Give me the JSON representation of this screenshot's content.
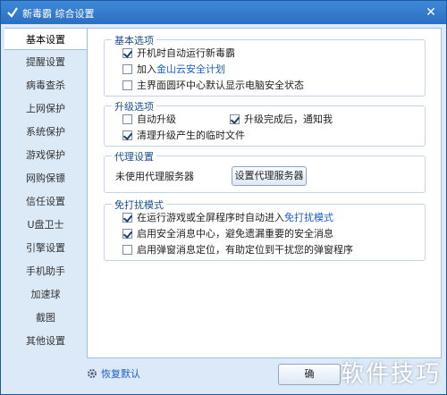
{
  "window": {
    "title": "新毒霸 综合设置",
    "close_glyph": "✕"
  },
  "sidebar": {
    "items": [
      {
        "label": "基本设置",
        "active": true
      },
      {
        "label": "提醒设置"
      },
      {
        "label": "病毒查杀"
      },
      {
        "label": "上网保护"
      },
      {
        "label": "系统保护"
      },
      {
        "label": "游戏保护"
      },
      {
        "label": "网购保镖"
      },
      {
        "label": "信任设置"
      },
      {
        "label": "U盘卫士"
      },
      {
        "label": "引擎设置"
      },
      {
        "label": "手机助手"
      },
      {
        "label": "加速球"
      },
      {
        "label": "截图"
      },
      {
        "label": "其他设置"
      }
    ]
  },
  "groups": {
    "basic": {
      "title": "基本选项",
      "options": [
        {
          "label": "开机时自动运行新毒霸",
          "checked": true
        },
        {
          "label_prefix": "加入",
          "link": "金山云安全计划",
          "checked": false
        },
        {
          "label": "主界面圆环中心默认显示电脑安全状态",
          "checked": false
        }
      ]
    },
    "upgrade": {
      "title": "升级选项",
      "options": [
        {
          "label": "自动升级",
          "checked": false
        },
        {
          "label": "升级完成后，通知我",
          "checked": true
        },
        {
          "label": "清理升级产生的临时文件",
          "checked": true
        }
      ]
    },
    "proxy": {
      "title": "代理设置",
      "status": "未使用代理服务器",
      "button": "设置代理服务器"
    },
    "nodisturb": {
      "title": "免打扰模式",
      "options": [
        {
          "label_prefix": "在运行游戏或全屏程序时自动进入",
          "link": "免打扰模式",
          "checked": true
        },
        {
          "label": "启用安全消息中心，避免遗漏重要的安全消息",
          "checked": true
        },
        {
          "label": "启用弹窗消息定位，有助定位到干扰您的弹窗程序",
          "checked": false
        }
      ]
    }
  },
  "footer": {
    "restore_label": "恢复默认",
    "ok_button_partial": "确",
    "watermark": "软件技巧"
  },
  "colors": {
    "accent": "#2b6fc0",
    "link": "#1a5fc8",
    "group_title": "#1c4f8c"
  }
}
